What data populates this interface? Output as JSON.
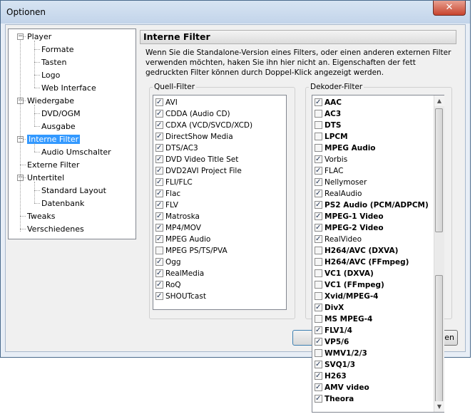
{
  "window": {
    "title": "Optionen",
    "close_glyph": "✕"
  },
  "tree": [
    {
      "label": "Player",
      "level": 0,
      "expander": "−"
    },
    {
      "label": "Formate",
      "level": 1
    },
    {
      "label": "Tasten",
      "level": 1
    },
    {
      "label": "Logo",
      "level": 1
    },
    {
      "label": "Web Interface",
      "level": 1
    },
    {
      "label": "Wiedergabe",
      "level": 0,
      "expander": "−"
    },
    {
      "label": "DVD/OGM",
      "level": 1
    },
    {
      "label": "Ausgabe",
      "level": 1
    },
    {
      "label": "Interne Filter",
      "level": 0,
      "expander": "−",
      "selected": true
    },
    {
      "label": "Audio Umschalter",
      "level": 1
    },
    {
      "label": "Externe Filter",
      "level": 0
    },
    {
      "label": "Untertitel",
      "level": 0,
      "expander": "−"
    },
    {
      "label": "Standard Layout",
      "level": 1
    },
    {
      "label": "Datenbank",
      "level": 1
    },
    {
      "label": "Tweaks",
      "level": 0
    },
    {
      "label": "Verschiedenes",
      "level": 0
    }
  ],
  "panel": {
    "title": "Interne Filter",
    "description": "Wenn Sie die Standalone-Version eines Filters, oder einen anderen externen Filter verwenden möchten, haken Sie ihn hier nicht an. Eigenschaften der fett gedruckten Filter können durch Doppel-Klick angezeigt werden."
  },
  "source_filters": {
    "label": "Quell-Filter",
    "items": [
      {
        "name": "AVI",
        "checked": true
      },
      {
        "name": "CDDA (Audio CD)",
        "checked": true
      },
      {
        "name": "CDXA (VCD/SVCD/XCD)",
        "checked": true
      },
      {
        "name": "DirectShow Media",
        "checked": true
      },
      {
        "name": "DTS/AC3",
        "checked": true
      },
      {
        "name": "DVD Video Title Set",
        "checked": true
      },
      {
        "name": "DVD2AVI Project File",
        "checked": true
      },
      {
        "name": "FLI/FLC",
        "checked": true
      },
      {
        "name": "Flac",
        "checked": true
      },
      {
        "name": "FLV",
        "checked": true
      },
      {
        "name": "Matroska",
        "checked": true
      },
      {
        "name": "MP4/MOV",
        "checked": true
      },
      {
        "name": "MPEG Audio",
        "checked": true
      },
      {
        "name": "MPEG PS/TS/PVA",
        "checked": false
      },
      {
        "name": "Ogg",
        "checked": true
      },
      {
        "name": "RealMedia",
        "checked": true
      },
      {
        "name": "RoQ",
        "checked": true
      },
      {
        "name": "SHOUTcast",
        "checked": true
      }
    ]
  },
  "decoder_filters": {
    "label": "Dekoder-Filter",
    "items": [
      {
        "name": "AAC",
        "checked": true,
        "bold": true
      },
      {
        "name": "AC3",
        "checked": false,
        "bold": true
      },
      {
        "name": "DTS",
        "checked": false,
        "bold": true
      },
      {
        "name": "LPCM",
        "checked": false,
        "bold": true
      },
      {
        "name": "MPEG Audio",
        "checked": false,
        "bold": true
      },
      {
        "name": "Vorbis",
        "checked": true,
        "bold": false
      },
      {
        "name": "FLAC",
        "checked": true,
        "bold": false
      },
      {
        "name": "Nellymoser",
        "checked": true,
        "bold": false
      },
      {
        "name": "RealAudio",
        "checked": true,
        "bold": false
      },
      {
        "name": "PS2 Audio (PCM/ADPCM)",
        "checked": true,
        "bold": true
      },
      {
        "name": "MPEG-1 Video",
        "checked": true,
        "bold": true
      },
      {
        "name": "MPEG-2 Video",
        "checked": true,
        "bold": true
      },
      {
        "name": "RealVideo",
        "checked": true,
        "bold": false
      },
      {
        "name": "H264/AVC (DXVA)",
        "checked": false,
        "bold": true
      },
      {
        "name": "H264/AVC (FFmpeg)",
        "checked": false,
        "bold": true
      },
      {
        "name": "VC1 (DXVA)",
        "checked": false,
        "bold": true
      },
      {
        "name": "VC1 (FFmpeg)",
        "checked": false,
        "bold": true
      },
      {
        "name": "Xvid/MPEG-4",
        "checked": false,
        "bold": true
      },
      {
        "name": "DivX",
        "checked": true,
        "bold": true
      },
      {
        "name": "MS MPEG-4",
        "checked": false,
        "bold": true
      },
      {
        "name": "FLV1/4",
        "checked": true,
        "bold": true
      },
      {
        "name": "VP5/6",
        "checked": true,
        "bold": true
      },
      {
        "name": "WMV1/2/3",
        "checked": false,
        "bold": true
      },
      {
        "name": "SVQ1/3",
        "checked": true,
        "bold": true
      },
      {
        "name": "H263",
        "checked": true,
        "bold": true
      },
      {
        "name": "AMV video",
        "checked": true,
        "bold": true
      },
      {
        "name": "Theora",
        "checked": true,
        "bold": true
      }
    ]
  },
  "buttons": {
    "ok_partial": "",
    "apply_partial": "en"
  },
  "scroll_arrows": {
    "up": "▲",
    "down": "▼"
  }
}
